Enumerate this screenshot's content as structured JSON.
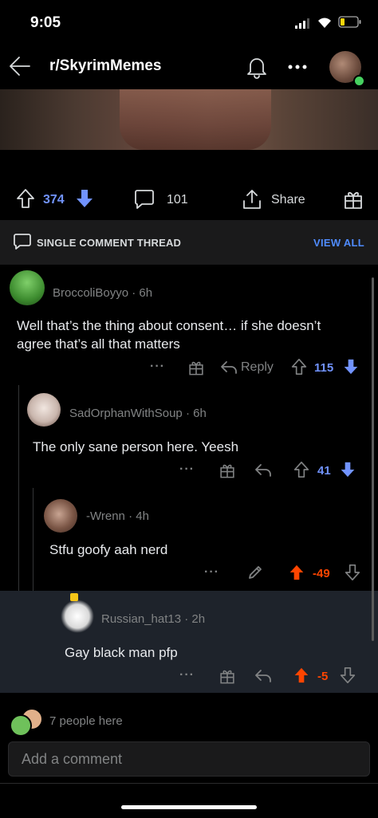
{
  "status_bar": {
    "time": "9:05"
  },
  "header": {
    "subreddit": "r/SkyrimMemes"
  },
  "post_actions": {
    "score": "374",
    "comments": "101",
    "share_label": "Share"
  },
  "thread_bar": {
    "label": "SINGLE COMMENT THREAD",
    "view_all": "VIEW ALL"
  },
  "comments": [
    {
      "user": "BroccoliBoyyo",
      "age": "· 6h",
      "text": "Well that’s the thing about consent… if she doesn’t agree that’s all that matters",
      "reply_label": "Reply",
      "score": "115",
      "vote": "none"
    },
    {
      "user": "SadOrphanWithSoup",
      "age": "· 6h",
      "text": "The only sane person here. Yeesh",
      "score": "41",
      "vote": "none"
    },
    {
      "user": "-Wrenn",
      "age": "· 4h",
      "text": "Stfu goofy aah nerd",
      "score": "-49",
      "vote": "up"
    },
    {
      "user": "Russian_hat13",
      "age": "· 2h",
      "text": "Gay black man pfp",
      "score": "-5",
      "vote": "up"
    }
  ],
  "footer": {
    "people_here": "7 people here",
    "comment_placeholder": "Add a comment"
  },
  "colors": {
    "upvoted": "#ff4500",
    "score_blue": "#7193ff",
    "link_blue": "#4f8cff"
  }
}
